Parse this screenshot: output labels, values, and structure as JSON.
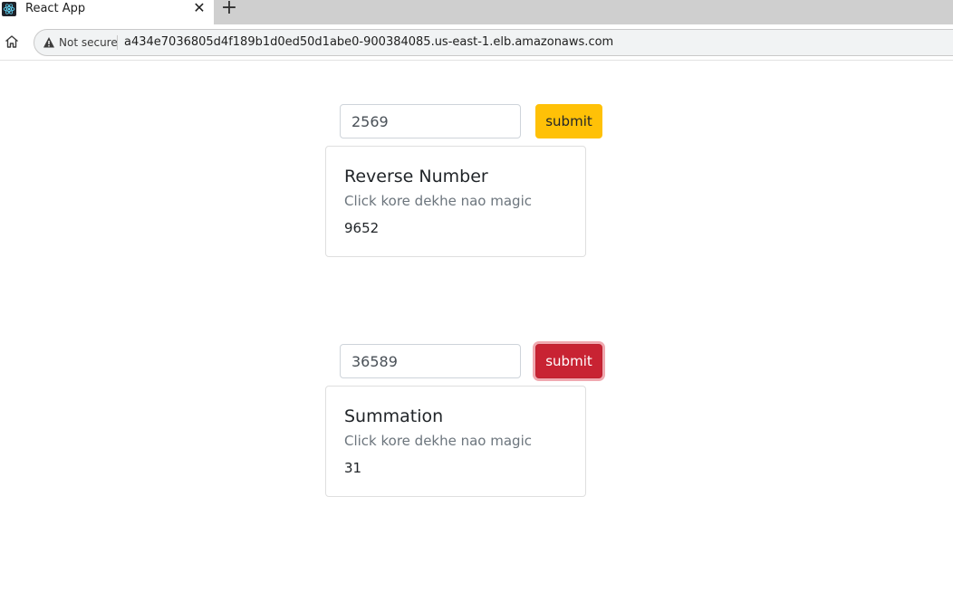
{
  "browser": {
    "tab_title": "React App",
    "tab_close_glyph": "✕",
    "new_tab_glyph": "+",
    "security_label": "Not secure",
    "url": "a434e7036805d4f189b1d0ed50d1abe0-900384085.us-east-1.elb.amazonaws.com",
    "icons": {
      "favicon": "react-logo-icon",
      "home": "home-icon",
      "warning": "warning-triangle-icon"
    }
  },
  "reverse": {
    "input_value": "2569",
    "button_label": "submit",
    "button_color": "#ffc107",
    "card_title": "Reverse Number",
    "card_subtitle": "Click kore dekhe nao magic",
    "card_result": "9652"
  },
  "summation": {
    "input_value": "36589",
    "button_label": "submit",
    "button_color": "#c82333",
    "card_title": "Summation",
    "card_subtitle": "Click kore dekhe nao magic",
    "card_result": "31"
  }
}
